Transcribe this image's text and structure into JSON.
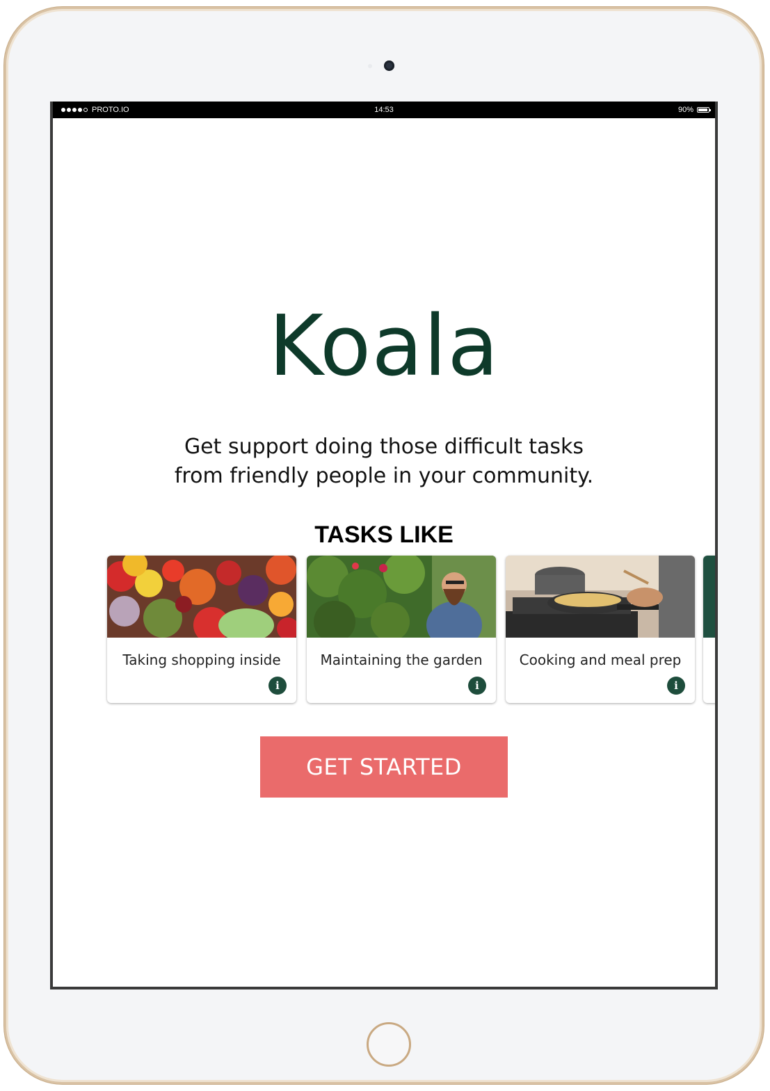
{
  "status_bar": {
    "carrier": "PROTO.IO",
    "time": "14:53",
    "battery": "90%"
  },
  "app": {
    "title": "Koala",
    "tagline_line1": "Get support doing those difficult tasks",
    "tagline_line2": "from friendly people in your community.",
    "tasks_heading": "TASKS LIKE"
  },
  "tasks": [
    {
      "label": "Taking shopping inside",
      "image": "fresh-produce-photo",
      "info_icon": "info-icon"
    },
    {
      "label": "Maintaining the garden",
      "image": "gardener-photo",
      "info_icon": "info-icon"
    },
    {
      "label": "Cooking and meal prep",
      "image": "cooking-photo",
      "info_icon": "info-icon"
    }
  ],
  "cta": {
    "label": "GET STARTED"
  },
  "colors": {
    "brand_dark_green": "#0e3a2a",
    "cta": "#ea6b6b",
    "info_icon": "#1e4d3c"
  }
}
